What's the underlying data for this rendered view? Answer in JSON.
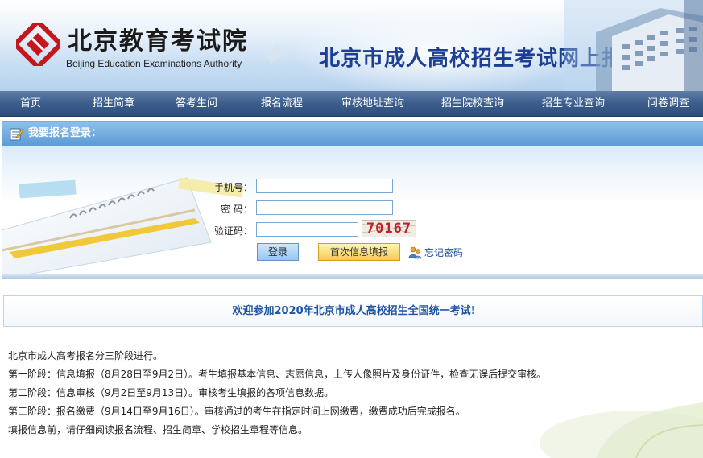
{
  "header": {
    "logo_cn": "北京教育考试院",
    "logo_en": "Beijing Education Examinations Authority",
    "site_title": "北京市成人高校招生考试网上报名"
  },
  "nav": {
    "items": [
      {
        "label": "首页"
      },
      {
        "label": "招生简章"
      },
      {
        "label": "答考生问"
      },
      {
        "label": "报名流程"
      },
      {
        "label": "审核地址查询"
      },
      {
        "label": "招生院校查询"
      },
      {
        "label": "招生专业查询"
      },
      {
        "label": "问卷调查"
      }
    ]
  },
  "login": {
    "heading": "我要报名登录：",
    "phone_label": "手机号：",
    "password_label": "密 码：",
    "captcha_label": "验证码：",
    "phone_value": "",
    "password_value": "",
    "captcha_value": "",
    "captcha_text": "70167",
    "login_button": "登录",
    "first_fill_button": "首次信息填报",
    "forgot_link": "忘记密码"
  },
  "welcome": "欢迎参加2020年北京市成人高校招生全国统一考试!",
  "info": {
    "lines": [
      "北京市成人高考报名分三阶段进行。",
      "第一阶段：信息填报（8月28日至9月2日）。考生填报基本信息、志愿信息，上传人像照片及身份证件，检查无误后提交审核。",
      "第二阶段：信息审核（9月2日至9月13日）。审核考生填报的各项信息数据。",
      "第三阶段：报名缴费（9月14日至9月16日）。审核通过的考生在指定时间上网缴费，缴费成功后完成报名。",
      "填报信息前，请仔细阅读报名流程、招生简章、学校招生章程等信息。"
    ]
  },
  "colors": {
    "nav_bg": "#3c5e8d",
    "title_blue": "#1c3f95",
    "logo_red": "#c4161c",
    "welcome_blue": "#1d54a3"
  }
}
